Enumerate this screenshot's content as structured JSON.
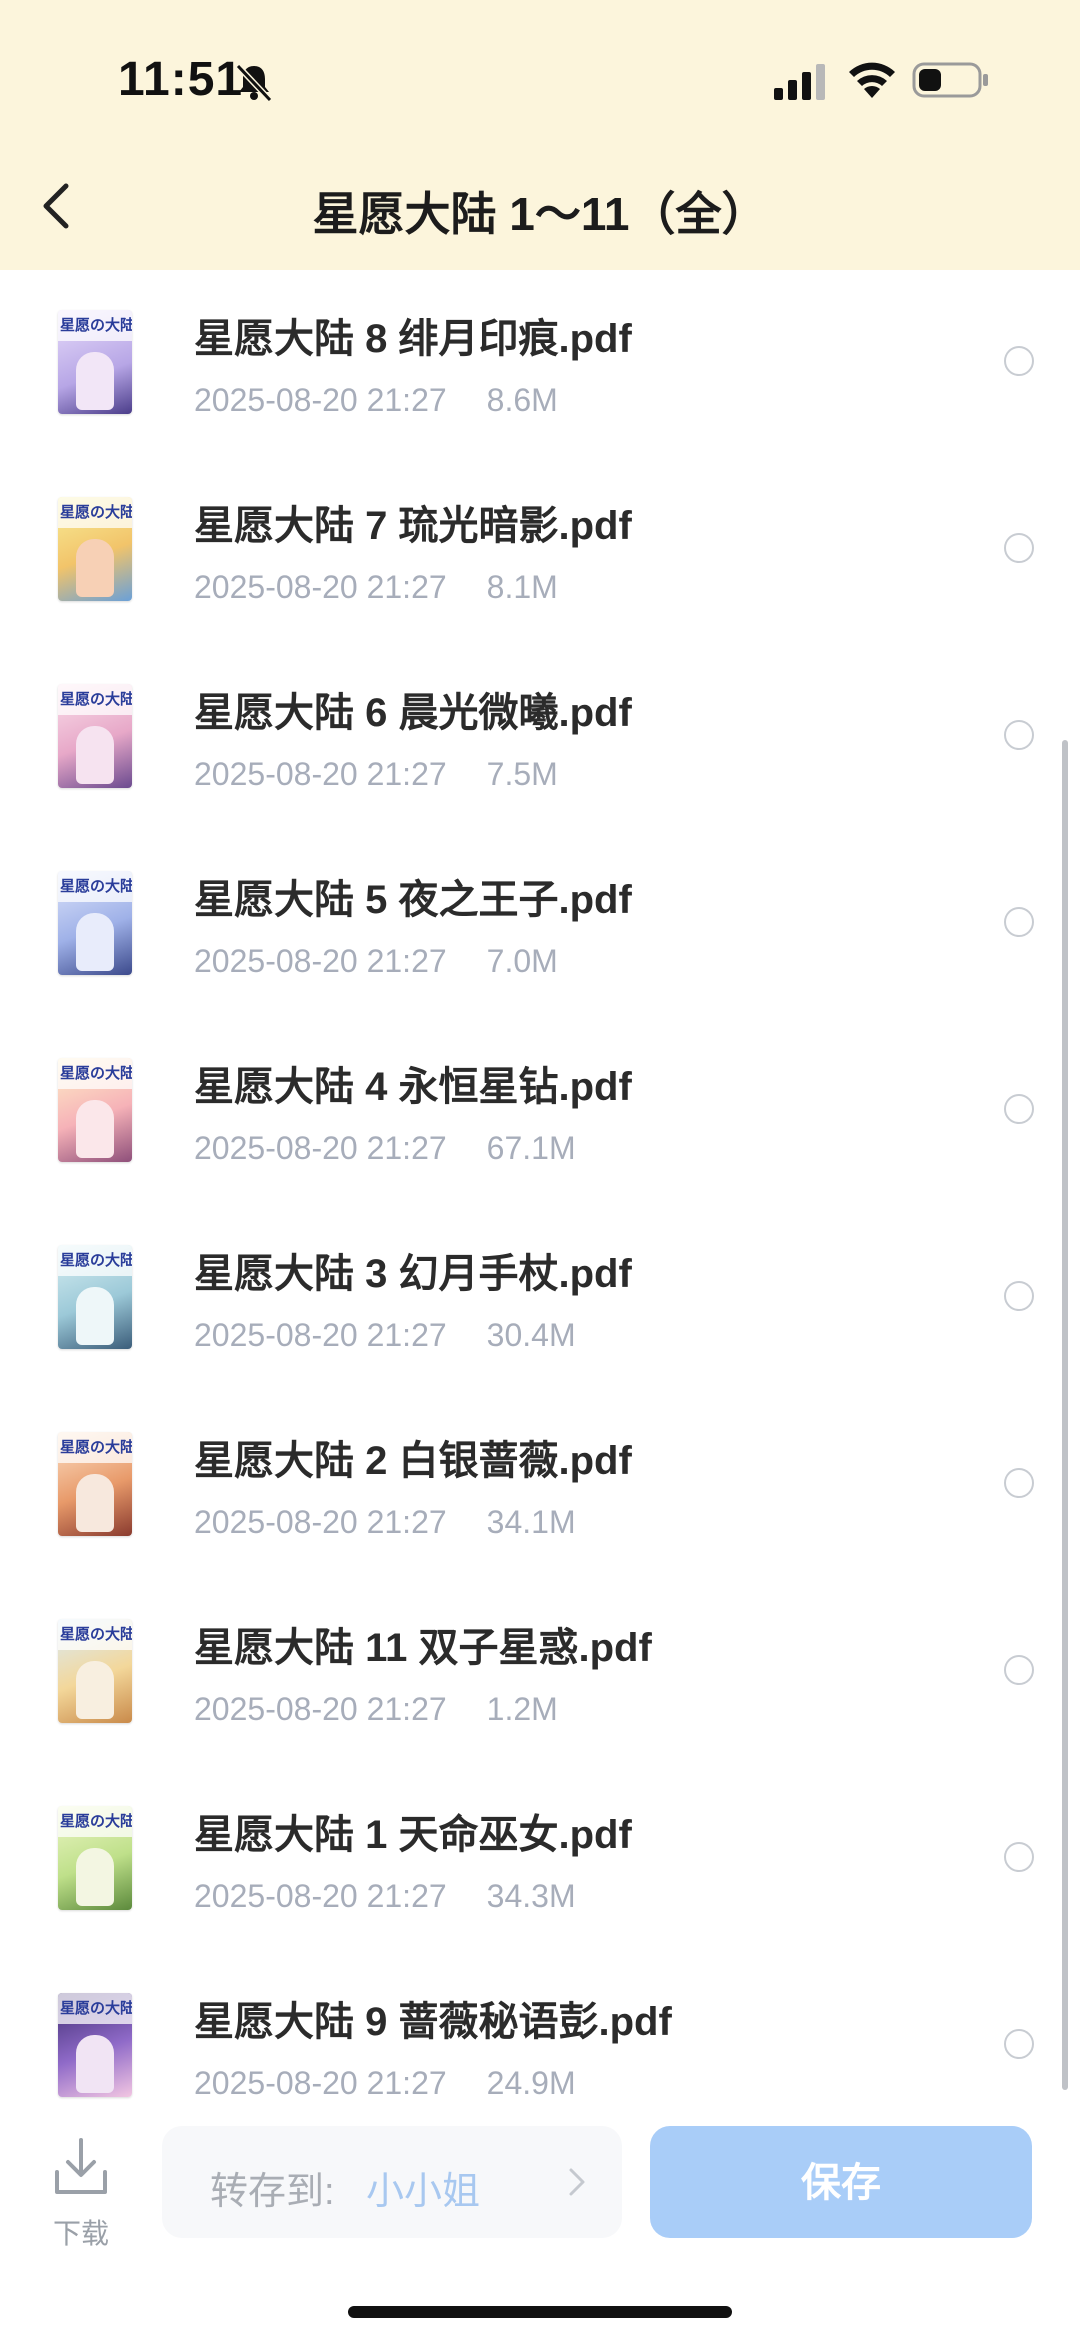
{
  "status_bar": {
    "time": "11:51"
  },
  "header": {
    "title": "星愿大陆 1～11（全）"
  },
  "files": [
    {
      "name": "星愿大陆 8 绯月印痕.pdf",
      "date": "2025-08-20 21:27",
      "size": "8.6M"
    },
    {
      "name": "星愿大陆 7 琉光暗影.pdf",
      "date": "2025-08-20 21:27",
      "size": "8.1M"
    },
    {
      "name": "星愿大陆 6 晨光微曦.pdf",
      "date": "2025-08-20 21:27",
      "size": "7.5M"
    },
    {
      "name": "星愿大陆 5 夜之王子.pdf",
      "date": "2025-08-20 21:27",
      "size": "7.0M"
    },
    {
      "name": "星愿大陆 4 永恒星钻.pdf",
      "date": "2025-08-20 21:27",
      "size": "67.1M"
    },
    {
      "name": "星愿大陆 3 幻月手杖.pdf",
      "date": "2025-08-20 21:27",
      "size": "30.4M"
    },
    {
      "name": "星愿大陆 2 白银蔷薇.pdf",
      "date": "2025-08-20 21:27",
      "size": "34.1M"
    },
    {
      "name": "星愿大陆 11 双子星惑.pdf",
      "date": "2025-08-20 21:27",
      "size": "1.2M"
    },
    {
      "name": "星愿大陆 1 天命巫女.pdf",
      "date": "2025-08-20 21:27",
      "size": "34.3M"
    },
    {
      "name": "星愿大陆  9  蔷薇秘语彭.pdf",
      "date": "2025-08-20 21:27",
      "size": "24.9M"
    }
  ],
  "thumbnail_text": "星愿の大陆",
  "bottom_bar": {
    "download_label": "下载",
    "save_to_label": "转存到:",
    "save_to_value": "小小姐",
    "save_label": "保存"
  },
  "colors": {
    "header_bg": "#fcf5dc",
    "accent": "#a9cdf8",
    "meta_text": "#a7adba"
  }
}
